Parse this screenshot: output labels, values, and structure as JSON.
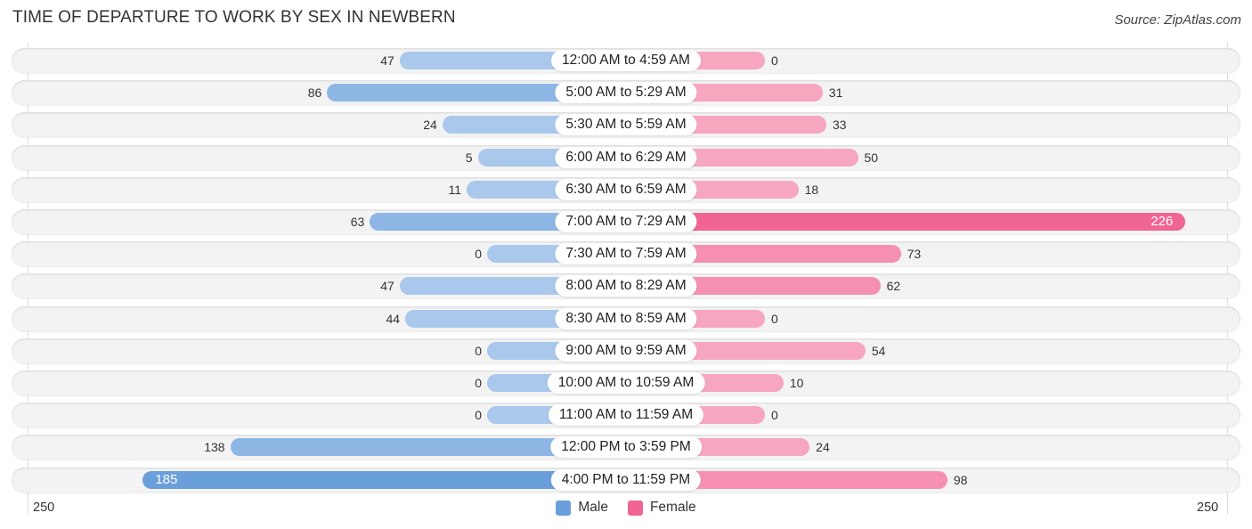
{
  "title": "TIME OF DEPARTURE TO WORK BY SEX IN NEWBERN",
  "source": "Source: ZipAtlas.com",
  "colors": {
    "male": "#6a9fdb",
    "male_light": "#a9c8ec",
    "female": "#f06592",
    "female_light": "#f7a6c0"
  },
  "chart_data": {
    "type": "bar",
    "orientation": "horizontal-diverging",
    "title": "TIME OF DEPARTURE TO WORK BY SEX IN NEWBERN",
    "categories": [
      "12:00 AM to 4:59 AM",
      "5:00 AM to 5:29 AM",
      "5:30 AM to 5:59 AM",
      "6:00 AM to 6:29 AM",
      "6:30 AM to 6:59 AM",
      "7:00 AM to 7:29 AM",
      "7:30 AM to 7:59 AM",
      "8:00 AM to 8:29 AM",
      "8:30 AM to 8:59 AM",
      "9:00 AM to 9:59 AM",
      "10:00 AM to 10:59 AM",
      "11:00 AM to 11:59 AM",
      "12:00 PM to 3:59 PM",
      "4:00 PM to 11:59 PM"
    ],
    "series": [
      {
        "name": "Male",
        "values": [
          47,
          86,
          24,
          5,
          11,
          63,
          0,
          47,
          44,
          0,
          0,
          0,
          138,
          185
        ]
      },
      {
        "name": "Female",
        "values": [
          0,
          31,
          33,
          50,
          18,
          226,
          73,
          62,
          0,
          54,
          10,
          0,
          24,
          98
        ]
      }
    ],
    "xlim": [
      250,
      250
    ],
    "axis_labels": {
      "left": "250",
      "right": "250"
    },
    "legend": {
      "position": "bottom-center",
      "entries": [
        "Male",
        "Female"
      ]
    }
  }
}
